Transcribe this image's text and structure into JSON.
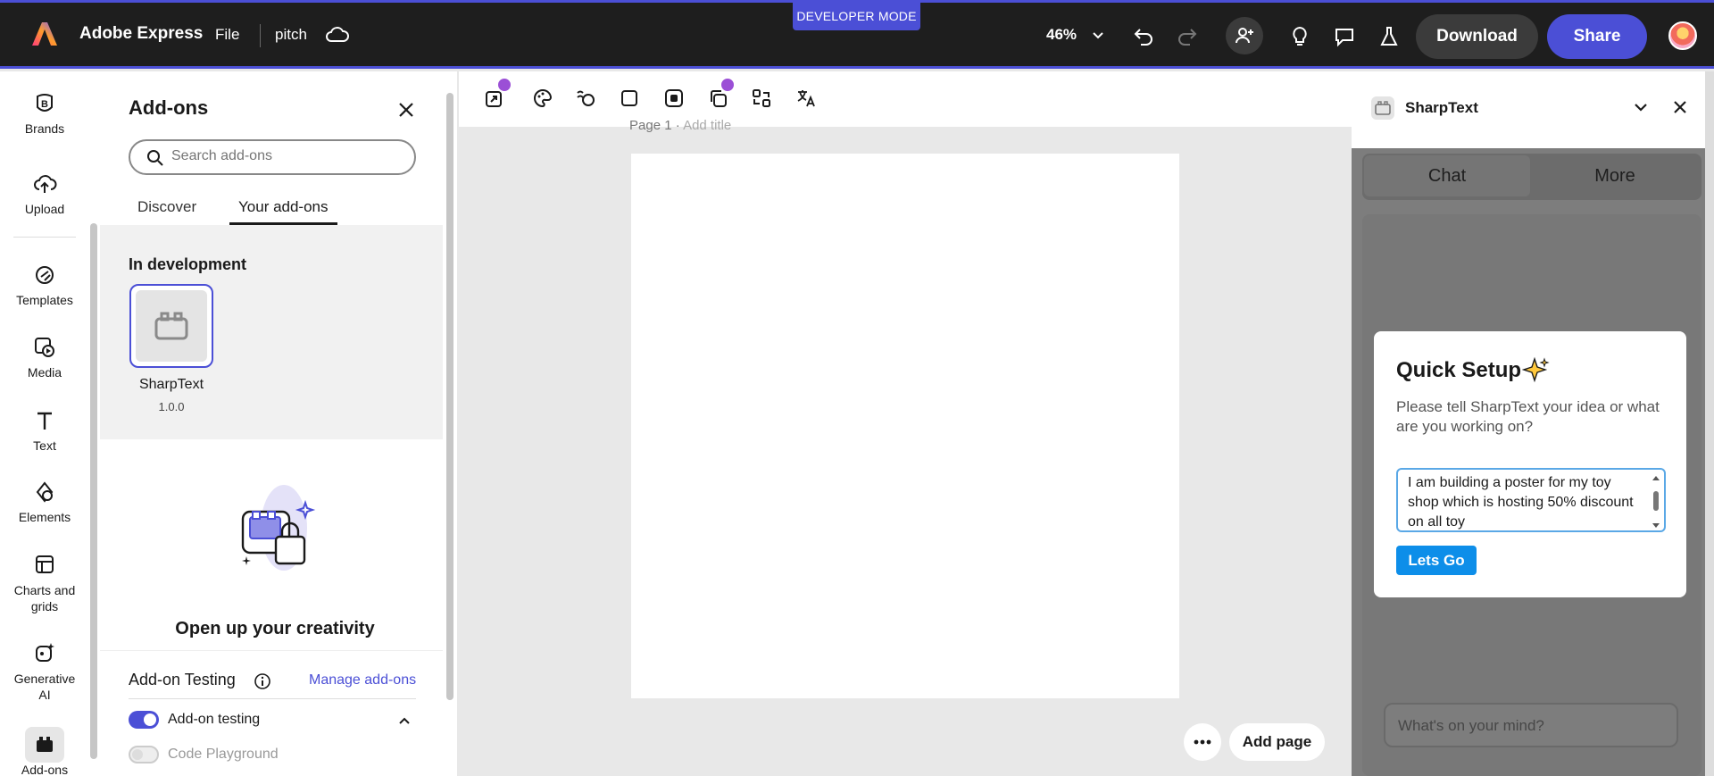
{
  "app": {
    "brand": "Adobe Express",
    "file_menu": "File",
    "doc_name": "pitch",
    "dev_mode_badge": "DEVELOPER MODE",
    "zoom": "46%",
    "download_label": "Download",
    "share_label": "Share",
    "accent_color": "#4b4fd6"
  },
  "rail": {
    "items": [
      {
        "label": "Brands",
        "icon": "brands-icon"
      },
      {
        "label": "Upload",
        "icon": "upload-icon"
      },
      {
        "label": "Templates",
        "icon": "templates-icon"
      },
      {
        "label": "Media",
        "icon": "media-icon"
      },
      {
        "label": "Text",
        "icon": "text-icon"
      },
      {
        "label": "Elements",
        "icon": "elements-icon"
      },
      {
        "label": "Charts and grids",
        "icon": "charts-icon"
      },
      {
        "label": "Generative AI",
        "icon": "generative-ai-icon"
      },
      {
        "label": "Add-ons",
        "icon": "addons-icon"
      }
    ]
  },
  "addons_panel": {
    "title": "Add-ons",
    "search_placeholder": "Search add-ons",
    "tabs": [
      "Discover",
      "Your add-ons"
    ],
    "active_tab": "Your add-ons",
    "section_title": "In development",
    "addon": {
      "name": "SharpText",
      "version": "1.0.0"
    },
    "promo_text": "Open up your creativity",
    "testing": {
      "title": "Add-on Testing",
      "manage_link": "Manage add-ons",
      "toggles": [
        {
          "label": "Add-on testing",
          "on": true
        },
        {
          "label": "Code Playground",
          "on": false
        }
      ]
    }
  },
  "canvas": {
    "page_label": "Page 1",
    "page_title_placeholder": "Add title",
    "add_page_label": "Add page"
  },
  "right_panel": {
    "title": "SharpText",
    "tabs": [
      "Chat",
      "More"
    ],
    "active_tab": "Chat",
    "modal": {
      "title": "Quick Setup",
      "subtitle": "Please tell SharpText your idea or what are you working on?",
      "input_value": "I am building a poster for my toy shop which is hosting 50% discount on all toy",
      "button_label": "Lets Go"
    },
    "chat_placeholder": "What's on your mind?"
  }
}
